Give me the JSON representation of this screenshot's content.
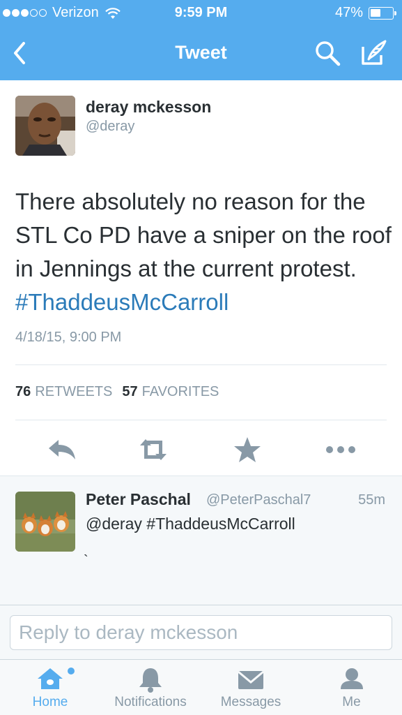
{
  "status_bar": {
    "signal_full": 3,
    "signal_empty": 2,
    "carrier": "Verizon",
    "time": "9:59 PM",
    "battery_percent": "47%",
    "battery_level": 0.47
  },
  "nav": {
    "title": "Tweet",
    "back_icon": "chevron-left-icon",
    "search_icon": "search-icon",
    "compose_icon": "compose-icon"
  },
  "tweet": {
    "author_name": "deray mckesson",
    "author_handle": "@deray",
    "text": "There absolutely no reason for the STL Co PD have a sniper on the roof in Jennings at the current protest. ",
    "hashtag": "#ThaddeusMcCarroll",
    "timestamp": "4/18/15, 9:00 PM",
    "retweets_count": "76",
    "retweets_label": "RETWEETS",
    "favorites_count": "57",
    "favorites_label": "FAVORITES",
    "actions": [
      "reply-icon",
      "retweet-icon",
      "favorite-star-icon",
      "more-icon"
    ]
  },
  "reply": {
    "name": "Peter Paschal",
    "handle": "@PeterPaschal7",
    "time": "55m",
    "text": "@deray #ThaddeusMcCarroll",
    "extra": "`"
  },
  "reply_input": {
    "placeholder": "Reply to deray mckesson"
  },
  "tabbar": {
    "items": [
      {
        "label": "Home",
        "icon": "home-icon",
        "active": true
      },
      {
        "label": "Notifications",
        "icon": "bell-icon",
        "active": false
      },
      {
        "label": "Messages",
        "icon": "envelope-icon",
        "active": false
      },
      {
        "label": "Me",
        "icon": "person-icon",
        "active": false
      }
    ]
  },
  "colors": {
    "brand_blue": "#55acee",
    "link_blue": "#2b7bb9",
    "muted_gray": "#8899a6",
    "text_dark": "#292f33"
  }
}
